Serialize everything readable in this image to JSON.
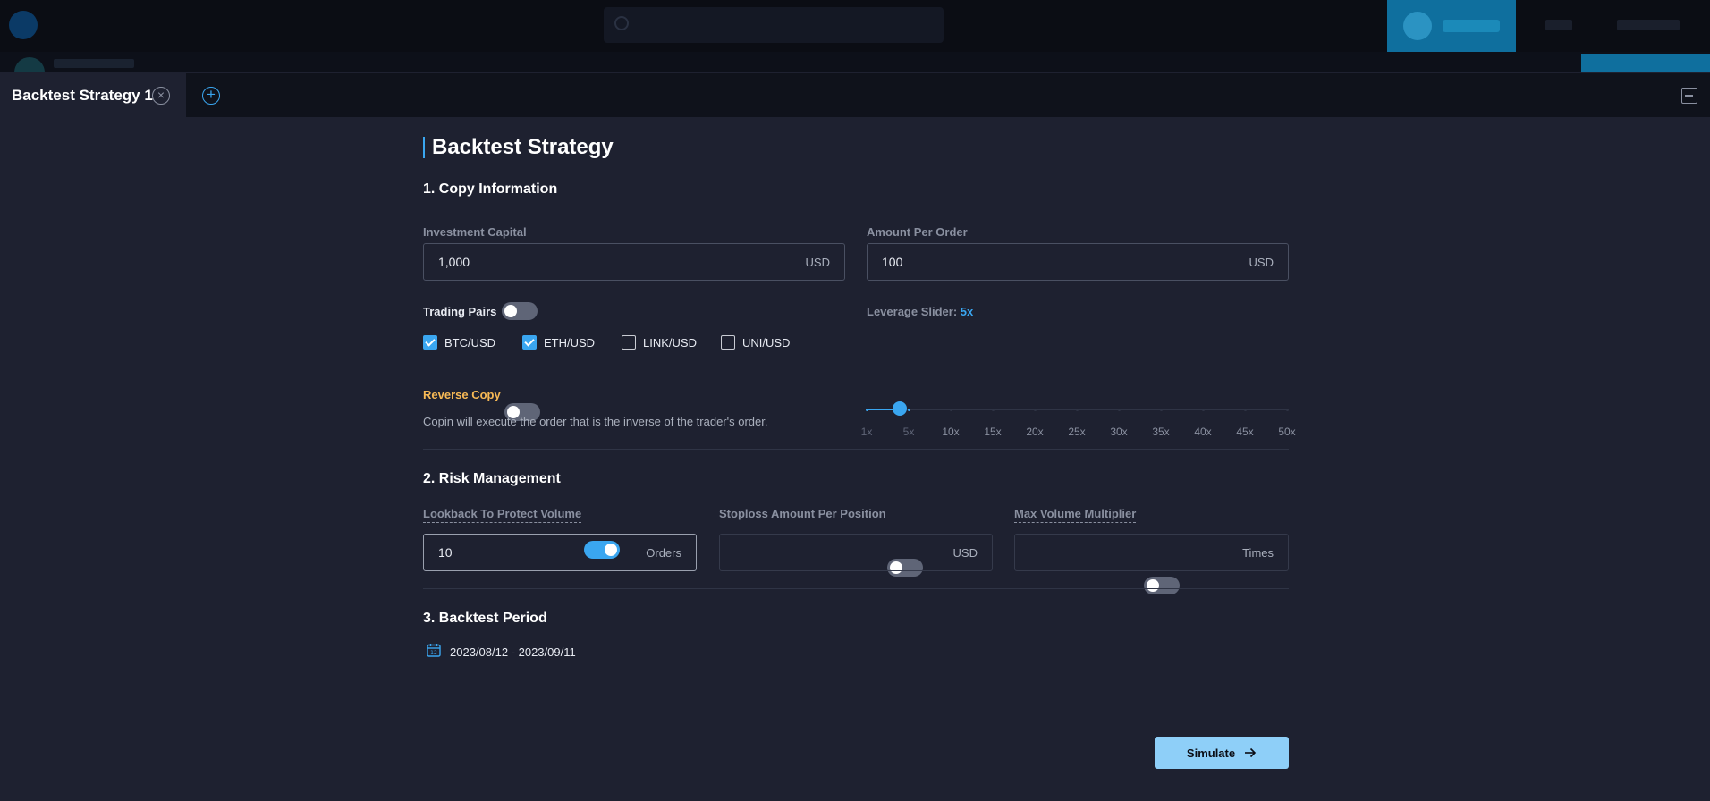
{
  "modal": {
    "tab_label": "Backtest Strategy 1",
    "title": "Backtest Strategy"
  },
  "copy_info": {
    "title": "1. Copy Information",
    "investment_capital": {
      "label": "Investment Capital",
      "value": "1,000",
      "unit": "USD"
    },
    "amount_per_order": {
      "label": "Amount Per Order",
      "value": "100",
      "unit": "USD"
    },
    "trading_pairs": {
      "label": "Trading Pairs",
      "toggle_on": false,
      "items": [
        {
          "label": "BTC/USD",
          "checked": true
        },
        {
          "label": "ETH/USD",
          "checked": true
        },
        {
          "label": "LINK/USD",
          "checked": false
        },
        {
          "label": "UNI/USD",
          "checked": false
        }
      ]
    },
    "leverage": {
      "label": "Leverage Slider:",
      "value_label": "5x",
      "value": 5,
      "ticks": [
        "1x",
        "5x",
        "10x",
        "15x",
        "20x",
        "25x",
        "30x",
        "35x",
        "40x",
        "45x",
        "50x"
      ]
    },
    "reverse_copy": {
      "label": "Reverse Copy",
      "toggle_on": false,
      "description": "Copin will execute the order that is the inverse of the trader's order."
    }
  },
  "risk": {
    "title": "2. Risk Management",
    "lookback": {
      "label": "Lookback To Protect Volume",
      "toggle_on": true,
      "value": "10",
      "unit": "Orders"
    },
    "stoploss": {
      "label": "Stoploss Amount Per Position",
      "toggle_on": false,
      "value": "",
      "unit": "USD"
    },
    "max_volume": {
      "label": "Max Volume Multiplier",
      "toggle_on": false,
      "value": "",
      "unit": "Times"
    }
  },
  "period": {
    "title": "3. Backtest Period",
    "range": "2023/08/12 - 2023/09/11"
  },
  "simulate_label": "Simulate",
  "colors": {
    "accent": "#3aa6f0",
    "warning_label": "#f7b955",
    "button_bg": "#8ecff8",
    "background": "#1e2130"
  }
}
